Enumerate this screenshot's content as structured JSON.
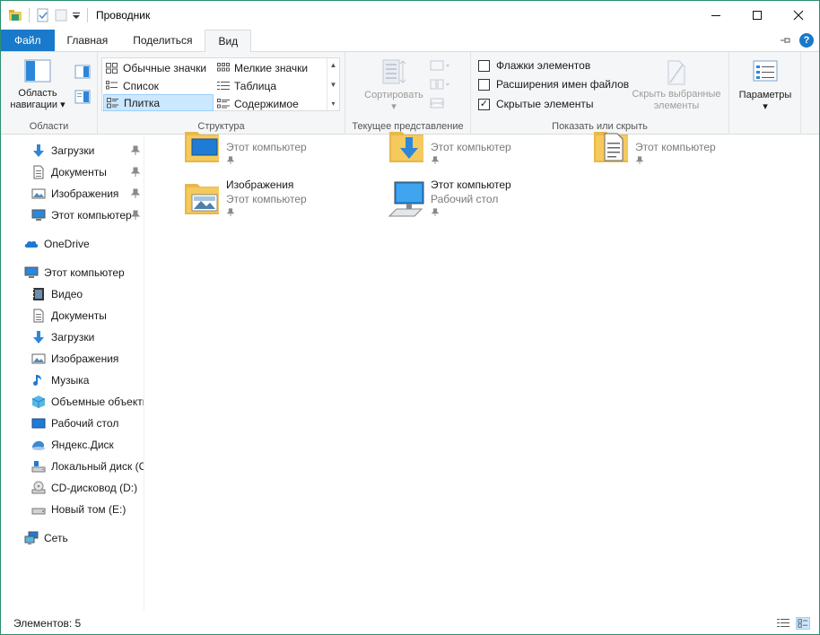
{
  "window": {
    "title": "Проводник"
  },
  "tabs": [
    {
      "label": "Файл"
    },
    {
      "label": "Главная"
    },
    {
      "label": "Поделиться"
    },
    {
      "label": "Вид"
    }
  ],
  "ribbon": {
    "areas": {
      "nav_pane_line1": "Область",
      "nav_pane_line2": "навигации",
      "group_label": "Области"
    },
    "structure": {
      "items": [
        {
          "label": "Обычные значки"
        },
        {
          "label": "Мелкие значки"
        },
        {
          "label": "Список"
        },
        {
          "label": "Таблица"
        },
        {
          "label": "Плитка"
        },
        {
          "label": "Содержимое"
        }
      ],
      "group_label": "Структура"
    },
    "current_view": {
      "sort_label": "Сортировать",
      "group_label": "Текущее представление"
    },
    "show_hide": {
      "checkboxes": [
        {
          "label": "Флажки элементов",
          "checked": false
        },
        {
          "label": "Расширения имен файлов",
          "checked": false
        },
        {
          "label": "Скрытые элементы",
          "checked": true
        }
      ],
      "hide_selected_line1": "Скрыть выбранные",
      "hide_selected_line2": "элементы",
      "group_label": "Показать или скрыть"
    },
    "options": {
      "label": "Параметры"
    }
  },
  "nav": {
    "quick_access": [
      {
        "label": "Загрузки",
        "icon": "download-icon"
      },
      {
        "label": "Документы",
        "icon": "document-icon"
      },
      {
        "label": "Изображения",
        "icon": "pictures-icon"
      },
      {
        "label": "Этот компьютер",
        "icon": "computer-icon"
      }
    ],
    "onedrive": "OneDrive",
    "this_pc": "Этот компьютер",
    "pc_items": [
      {
        "label": "Видео",
        "icon": "video-icon"
      },
      {
        "label": "Документы",
        "icon": "document-icon"
      },
      {
        "label": "Загрузки",
        "icon": "download-icon"
      },
      {
        "label": "Изображения",
        "icon": "pictures-icon"
      },
      {
        "label": "Музыка",
        "icon": "music-icon"
      },
      {
        "label": "Объемные объекты",
        "icon": "3d-objects-icon"
      },
      {
        "label": "Рабочий стол",
        "icon": "desktop-icon"
      },
      {
        "label": "Яндекс.Диск",
        "icon": "yandex-disk-icon"
      },
      {
        "label": "Локальный диск (C:)",
        "icon": "local-disk-icon"
      },
      {
        "label": "CD-дисковод (D:)",
        "icon": "cd-drive-icon"
      },
      {
        "label": "Новый том (E:)",
        "icon": "volume-icon"
      }
    ],
    "network": "Сеть"
  },
  "content": {
    "tiles": [
      {
        "name": "",
        "sub": "Этот компьютер",
        "icon": "desktop-folder-icon"
      },
      {
        "name": "",
        "sub": "Этот компьютер",
        "icon": "downloads-folder-icon"
      },
      {
        "name": "",
        "sub": "Этот компьютер",
        "icon": "documents-folder-icon"
      },
      {
        "name": "Изображения",
        "sub": "Этот компьютер",
        "icon": "pictures-folder-icon"
      },
      {
        "name": "Этот компьютер",
        "sub": "Рабочий стол",
        "icon": "computer-icon"
      }
    ]
  },
  "status": {
    "items_text": "Элементов: 5"
  },
  "colors": {
    "accent": "#1979ca",
    "selection": "#cce8ff",
    "folder": "#f5c95b"
  }
}
